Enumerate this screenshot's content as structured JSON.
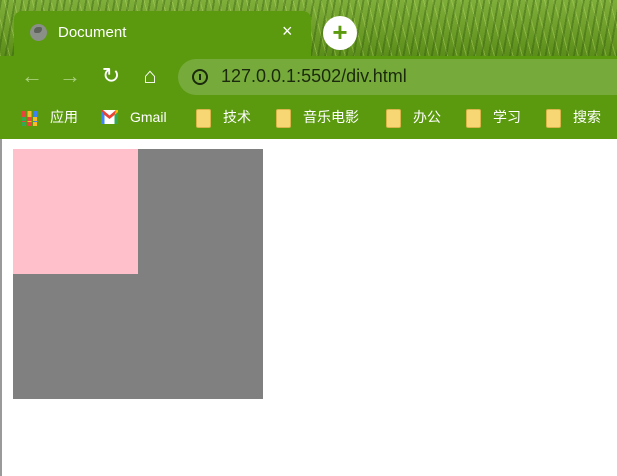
{
  "tab": {
    "title": "Document",
    "close": "×"
  },
  "newtab": {
    "label": "+"
  },
  "nav": {
    "back": "←",
    "forward": "→",
    "reload": "↻",
    "home": "⌂"
  },
  "address": {
    "url": "127.0.0.1:5502/div.html"
  },
  "bookmarks": [
    {
      "label": "应用",
      "icon": "apps-grid-icon"
    },
    {
      "label": "Gmail",
      "icon": "gmail-icon"
    },
    {
      "label": "技术",
      "icon": "folder-icon"
    },
    {
      "label": "音乐电影",
      "icon": "folder-icon"
    },
    {
      "label": "办公",
      "icon": "folder-icon"
    },
    {
      "label": "学习",
      "icon": "folder-icon"
    },
    {
      "label": "搜索",
      "icon": "folder-icon"
    }
  ],
  "colors": {
    "theme_green": "#5b9a0f",
    "outer_box": "#808080",
    "inner_box": "#ffc0cb"
  }
}
